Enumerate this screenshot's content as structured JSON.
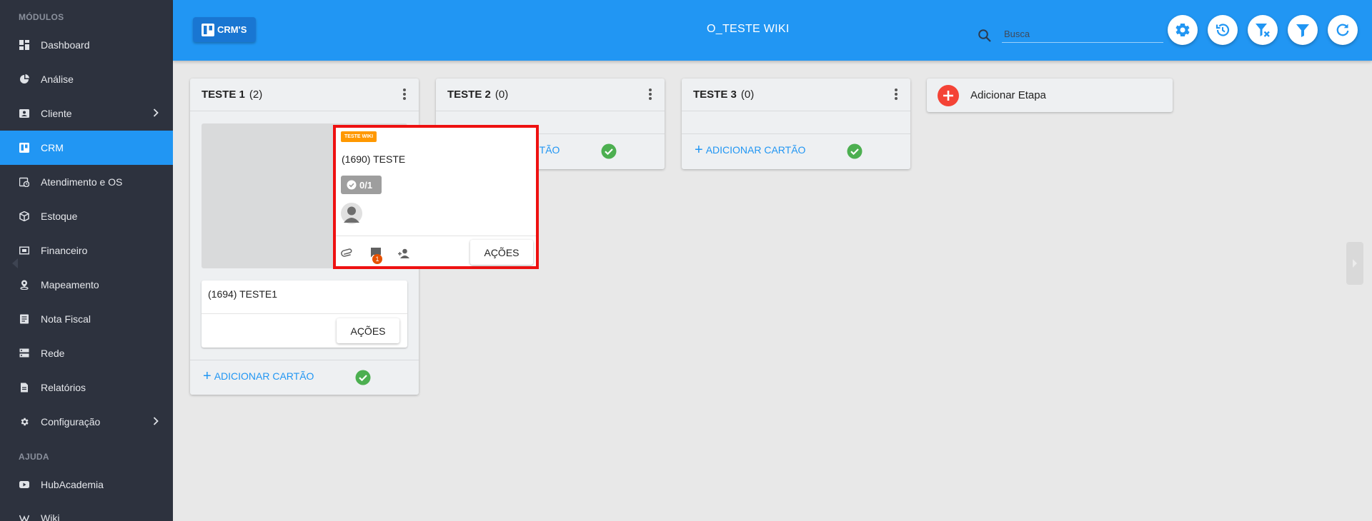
{
  "sidebar": {
    "sections": [
      {
        "title": "MÓDULOS"
      },
      {
        "title": "AJUDA"
      }
    ],
    "items": [
      {
        "label": "Dashboard",
        "icon": "dashboard-icon"
      },
      {
        "label": "Análise",
        "icon": "chart-pie-icon"
      },
      {
        "label": "Cliente",
        "icon": "contact-card-icon",
        "has_submenu": true
      },
      {
        "label": "CRM",
        "icon": "kanban-board-icon",
        "active": true
      },
      {
        "label": "Atendimento e OS",
        "icon": "clock-calendar-icon"
      },
      {
        "label": "Estoque",
        "icon": "package-icon"
      },
      {
        "label": "Financeiro",
        "icon": "money-icon"
      },
      {
        "label": "Mapeamento",
        "icon": "map-pin-icon"
      },
      {
        "label": "Nota Fiscal",
        "icon": "document-icon"
      },
      {
        "label": "Rede",
        "icon": "server-icon"
      },
      {
        "label": "Relatórios",
        "icon": "report-icon"
      },
      {
        "label": "Configuração",
        "icon": "gear-icon",
        "has_submenu": true
      }
    ],
    "help_items": [
      {
        "label": "HubAcademia",
        "icon": "youtube-icon"
      },
      {
        "label": "Wiki",
        "icon": "wikipedia-icon"
      }
    ]
  },
  "header": {
    "crms_button": "CRM'S",
    "board_title": "O_TESTE WIKI",
    "search_placeholder": "Busca",
    "buttons": [
      "settings-icon",
      "history-icon",
      "filter-clear-icon",
      "filter-icon",
      "refresh-icon"
    ]
  },
  "columns": [
    {
      "title": "TESTE 1",
      "count": "(2)",
      "cards": [
        {
          "title": "(1694) TESTE1",
          "actions_label": "AÇÕES"
        }
      ],
      "add_card_label": "ADICIONAR CARTÃO"
    },
    {
      "title": "TESTE 2",
      "count": "(0)",
      "cards": [],
      "add_card_label": "ADICIONAR CARTÃO"
    },
    {
      "title": "TESTE 3",
      "count": "(0)",
      "cards": [],
      "add_card_label": "ADICIONAR CARTÃO"
    }
  ],
  "dragged_card": {
    "tag": "TESTE WIKI",
    "title": "(1690) TESTE",
    "checklist": "0/1",
    "comment_count": "1",
    "actions_label": "AÇÕES"
  },
  "add_stage_label": "Adicionar Etapa",
  "colors": {
    "sidebar_bg": "#2d323e",
    "accent": "#2196f3",
    "tag": "#ff9800",
    "success": "#4caf50",
    "danger": "#f44336",
    "highlight": "#ee1111"
  }
}
